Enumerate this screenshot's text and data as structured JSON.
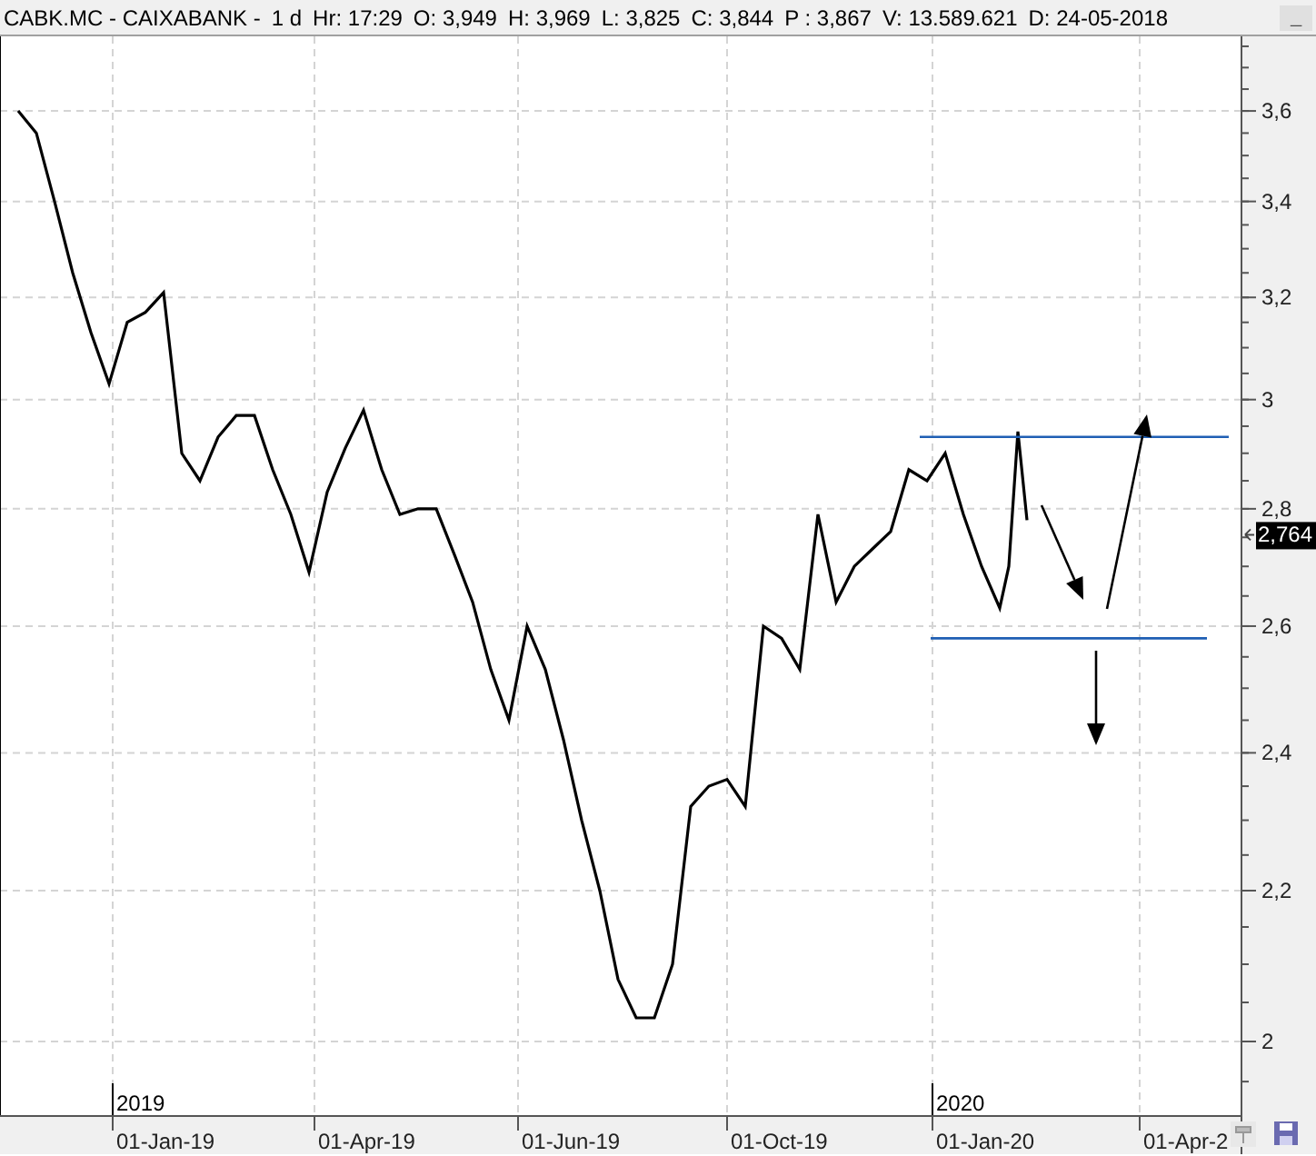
{
  "header": {
    "symbol": "CABK.MC - CAIXABANK -",
    "interval": "1 d",
    "fields": [
      {
        "label": "Hr:",
        "value": "17:29"
      },
      {
        "label": "O:",
        "value": "3,949"
      },
      {
        "label": "H:",
        "value": "3,969"
      },
      {
        "label": "L:",
        "value": "3,825"
      },
      {
        "label": "C:",
        "value": "3,844"
      },
      {
        "label": "P :",
        "value": "3,867"
      },
      {
        "label": "V:",
        "value": "13.589.621"
      },
      {
        "label": "D:",
        "value": "24-05-2018"
      }
    ],
    "minimize": "_"
  },
  "chart": {
    "y_axis_labels": [
      "3,6",
      "3,4",
      "3,2",
      "3",
      "2,8",
      "2,6",
      "2,4",
      "2,2",
      "2"
    ],
    "x_axis_labels": [
      "01-Jan-19",
      "01-Apr-19",
      "01-Jun-19",
      "01-Oct-19",
      "01-Jan-20",
      "01-Apr-2"
    ],
    "year_markers": [
      {
        "label": "2019"
      },
      {
        "label": "2020"
      }
    ],
    "last_price": {
      "label": "2,764"
    }
  }
}
